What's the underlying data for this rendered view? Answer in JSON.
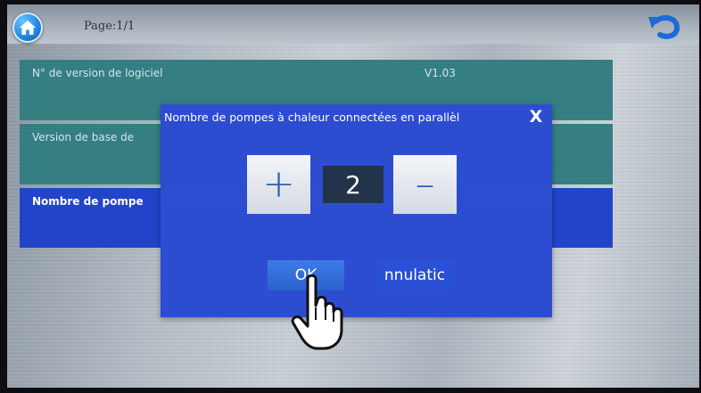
{
  "header": {
    "home_icon": "home-icon",
    "page_label": "Page:1/1",
    "back_icon": "undo-arrow-icon"
  },
  "rows": [
    {
      "label": "N° de version de logiciel",
      "value": "V1.03"
    },
    {
      "label": "Version de base de"
    },
    {
      "label": "Nombre de pompe"
    }
  ],
  "dialog": {
    "title": "Nombre de pompes à chaleur connectées en parallèl",
    "close_label": "X",
    "plus_label": "+",
    "value": "2",
    "minus_label": "–",
    "ok_label": "OK",
    "cancel_label": "nnulatic"
  },
  "overlay": {
    "cursor_icon": "pointing-hand-icon"
  },
  "colors": {
    "row_teal": "#2d7a7e",
    "row_selected": "#2244c8",
    "dialog_bg": "#2547cf",
    "value_box": "#23334c"
  }
}
